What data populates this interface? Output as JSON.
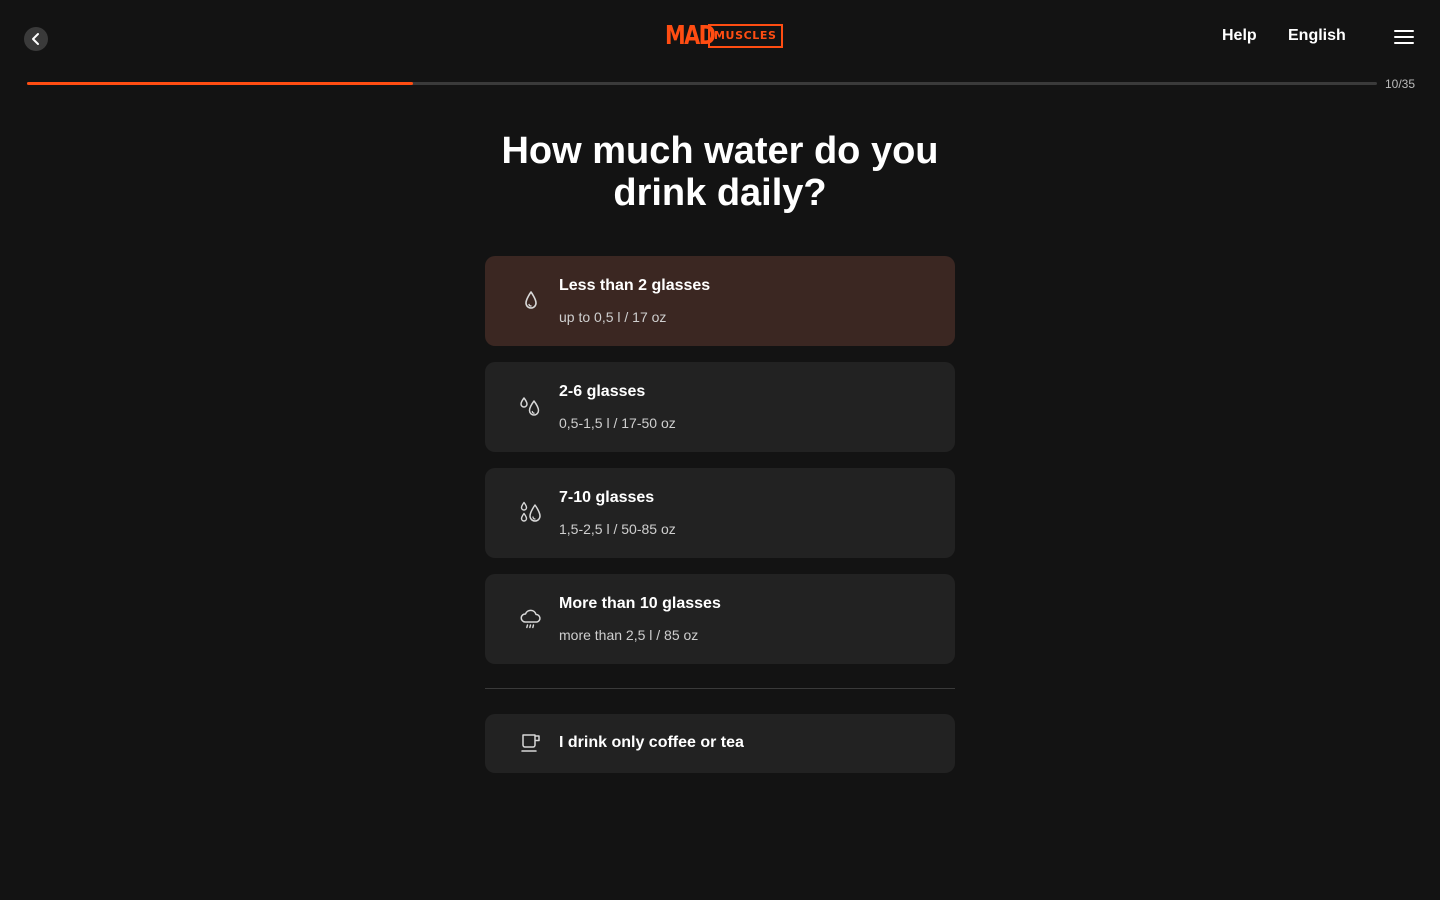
{
  "header": {
    "logo_primary": "MAD",
    "logo_secondary": "MUSCLES",
    "help_label": "Help",
    "language_label": "English"
  },
  "progress": {
    "current": 10,
    "total": 35,
    "label": "10/35"
  },
  "question": {
    "title": "How much water do you drink daily?"
  },
  "options": [
    {
      "title": "Less than 2 glasses",
      "subtitle": "up to 0,5 l / 17 oz",
      "icon": "water-drop-icon",
      "selected": true
    },
    {
      "title": "2-6 glasses",
      "subtitle": "0,5-1,5 l / 17-50 oz",
      "icon": "two-drops-icon",
      "selected": false
    },
    {
      "title": "7-10 glasses",
      "subtitle": "1,5-2,5 l / 50-85 oz",
      "icon": "three-drops-icon",
      "selected": false
    },
    {
      "title": "More than 10 glasses",
      "subtitle": "more than 2,5 l / 85 oz",
      "icon": "rain-cloud-icon",
      "selected": false
    }
  ],
  "alt_option": {
    "title": "I drink only coffee or tea",
    "icon": "coffee-cup-icon"
  },
  "colors": {
    "accent": "#ff4d12",
    "background": "#131313",
    "card": "#222222",
    "card_selected": "#3b2722"
  }
}
